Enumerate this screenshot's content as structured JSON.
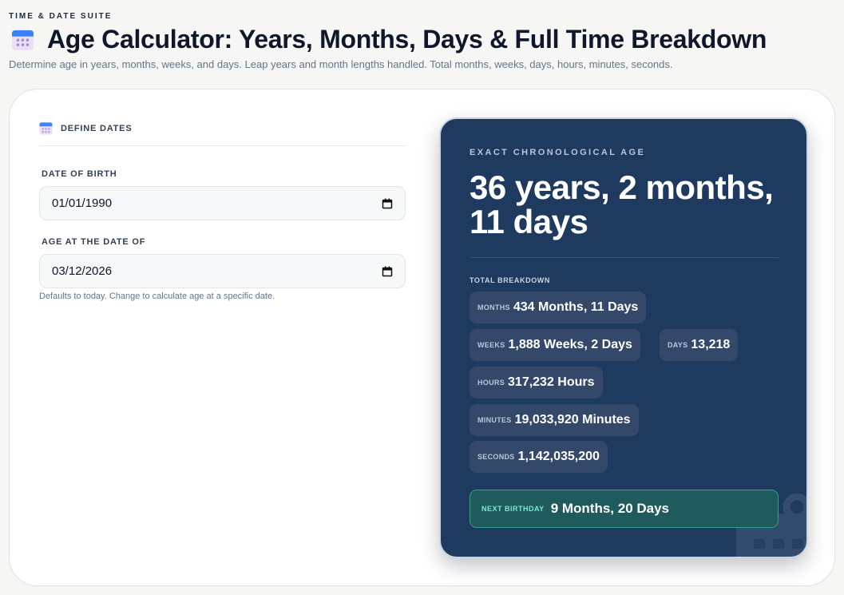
{
  "header": {
    "suite": "TIME & DATE SUITE",
    "title_icon": "calendar-icon",
    "title": "Age Calculator: Years, Months, Days & Full Time Breakdown",
    "subtitle": "Determine age in years, months, weeks, and days. Leap years and month lengths handled. Total months, weeks, days, hours, minutes, seconds."
  },
  "inputs": {
    "section_icon": "calendar-icon",
    "section_title": "DEFINE DATES",
    "dob_label": "DATE OF BIRTH",
    "dob_value": "01/01/1990",
    "asof_label": "AGE AT THE DATE OF",
    "asof_value": "03/12/2026",
    "hint": "Defaults to today. Change to calculate age at a specific date."
  },
  "result": {
    "eyebrow": "EXACT CHRONOLOGICAL AGE",
    "age": "36 years, 2 months, 11 days",
    "breakdown_title": "TOTAL BREAKDOWN",
    "items": [
      {
        "label": "MONTHS",
        "value": "434 Months, 11 Days"
      },
      {
        "label": "WEEKS",
        "value": "1,888 Weeks, 2 Days"
      },
      {
        "label": "DAYS",
        "value": "13,218"
      },
      {
        "label": "HOURS",
        "value": "317,232 Hours"
      },
      {
        "label": "MINUTES",
        "value": "19,033,920 Minutes"
      },
      {
        "label": "SECONDS",
        "value": "1,142,035,200"
      }
    ],
    "next_birthday_label": "NEXT BIRTHDAY",
    "next_birthday_value": "9 Months, 20 Days"
  },
  "colors": {
    "panel_bg": "#1f3a5f",
    "pill_bg": "#34496a",
    "accent_green": "#2ea08c",
    "title_text": "#0f172a"
  }
}
